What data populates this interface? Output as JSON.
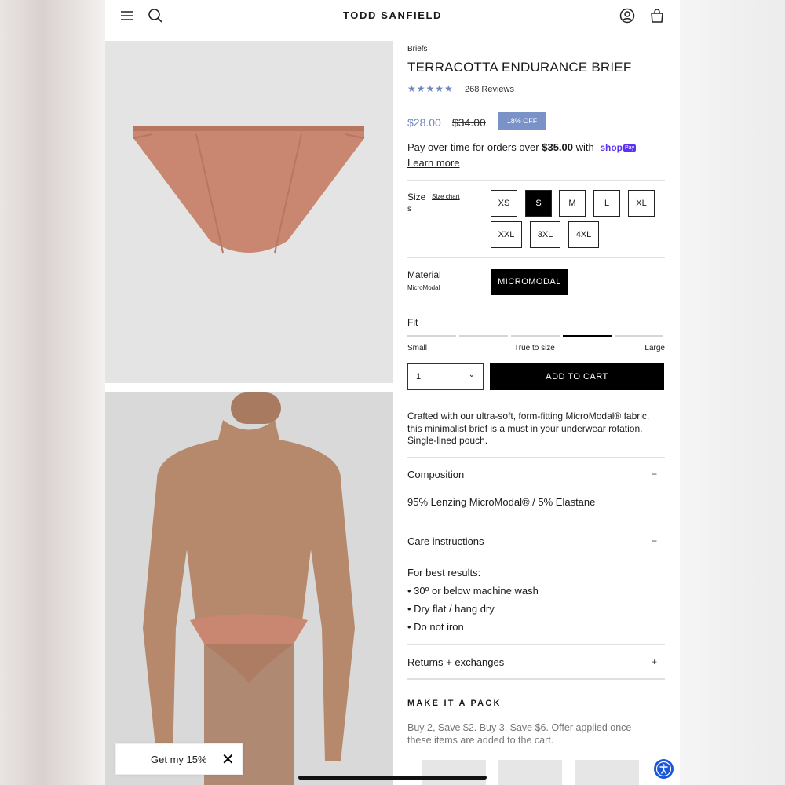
{
  "header": {
    "brand": "TODD SANFIELD"
  },
  "product": {
    "breadcrumb": "Briefs",
    "title": "TERRACOTTA ENDURANCE BRIEF",
    "stars": "★★★★★",
    "reviews": "268 Reviews",
    "price": "$28.00",
    "old_price": "$34.00",
    "discount": "18% OFF",
    "pay_text": "Pay over time for orders over ",
    "pay_amount": "$35.00",
    "pay_with": " with ",
    "shop_pay": "shop",
    "pay_tag": "Pay",
    "learn_more": "Learn more",
    "size_label": "Size",
    "size_chart": "Size chart",
    "size_selected": "s",
    "sizes": [
      "XS",
      "S",
      "M",
      "L",
      "XL",
      "XXL",
      "3XL",
      "4XL"
    ],
    "material_label": "Material",
    "material_selected": "MicroModal",
    "material_option": "MICROMODAL",
    "fit_label": "Fit",
    "fit_small": "Small",
    "fit_true": "True to size",
    "fit_large": "Large",
    "fit_level": 0.7,
    "quantity": "1",
    "add_to_cart": "ADD TO CART",
    "description": "Crafted with our ultra-soft, form-fitting MicroModal® fabric, this minimalist brief is a must in your underwear rotation. Single-lined pouch.",
    "composition_label": "Composition",
    "composition_value": "95% Lenzing MicroModal® / 5% Elastane",
    "care_label": "Care instructions",
    "care_lines": [
      "For best results:",
      "• 30º or below machine wash",
      "• Dry flat / hang dry",
      "• Do not iron"
    ],
    "returns_label": "Returns + exchanges",
    "accordion_minus": "−",
    "accordion_plus": "+",
    "pack_title": "MAKE IT A PACK",
    "pack_desc": "Buy 2, Save $2. Buy 3, Save $6. Offer applied once these items are added to the cart."
  },
  "popup": {
    "text": "Get my 15%",
    "close": "✕"
  },
  "colors": {
    "accent": "#7b92c9",
    "product": "#c98670",
    "shop_pay": "#5a31f4"
  }
}
